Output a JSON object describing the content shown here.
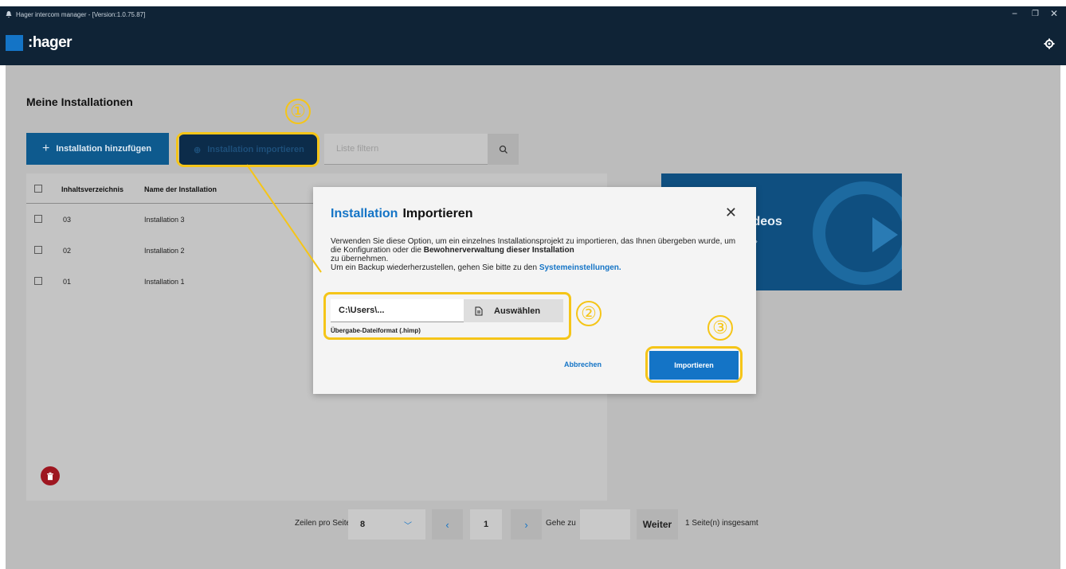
{
  "window": {
    "title": "Hager intercom manager - [Version:1.0.75.87]"
  },
  "brand": {
    "name": ":hager",
    "accent": "#1474c6"
  },
  "page": {
    "heading": "Meine Installationen"
  },
  "toolbar": {
    "add_label": "Installation hinzufügen",
    "import_label": "Installation importieren",
    "filter_placeholder": "Liste filtern"
  },
  "table": {
    "columns": [
      "Inhaltsverzeichnis",
      "Name der Installation"
    ],
    "rows": [
      {
        "index": "03",
        "name": "Installation 3"
      },
      {
        "index": "02",
        "name": "Installation 2"
      },
      {
        "index": "01",
        "name": "Installation 1"
      }
    ]
  },
  "promo": {
    "text": "ideos"
  },
  "pagination": {
    "rows_label": "Zeilen pro Seite",
    "rows_value": "8",
    "page": "1",
    "goto_label": "Gehe zu",
    "goto_button": "Weiter",
    "total": "1 Seite(n) insgesamt"
  },
  "dialog": {
    "title_part1": "Installation",
    "title_part2": "Importieren",
    "text_1": "Verwenden Sie diese Option, um ein einzelnes Installationsprojekt zu importieren, das Ihnen übergeben wurde, um die Konfiguration oder die ",
    "text_bold": "Bewohnerverwaltung dieser Installation",
    "text_2": " zu übernehmen.",
    "text_3": "Um ein Backup wiederherzustellen, gehen Sie bitte zu den ",
    "text_link": "Systemeinstellungen.",
    "file_path": "C:\\Users\\...",
    "choose_label": "Auswählen",
    "file_hint": "Übergabe-Dateiformat (.himp)",
    "cancel_label": "Abbrechen",
    "import_label": "Importieren"
  },
  "annotations": {
    "n1": "①",
    "n2": "②",
    "n3": "③",
    "color": "#f5c518"
  }
}
